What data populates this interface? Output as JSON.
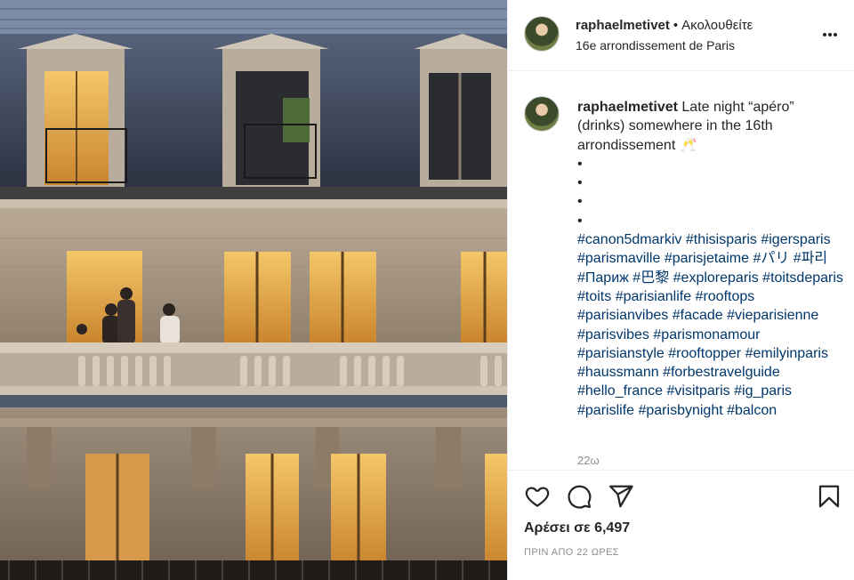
{
  "photo": {
    "alt": ""
  },
  "header": {
    "username": "raphaelmetivet",
    "separator": "•",
    "follow_label": "Ακολουθείτε",
    "location": "16e arrondissement de Paris",
    "more_icon": "more-dots-icon"
  },
  "caption": {
    "username": "raphaelmetivet",
    "text": "Late night “apéro” (drinks) somewhere in the 16th arrondissement 🥂",
    "dots": [
      "•",
      "•",
      "•",
      "•"
    ],
    "hashtags": [
      "#canon5dmarkiv",
      "#thisisparis",
      "#igersparis",
      "#parismaville",
      "#parisjetaime",
      "#パリ",
      "#파리",
      "#Париж",
      "#巴黎",
      "#exploreparis",
      "#toitsdeparis",
      "#toits",
      "#parisianlife",
      "#rooftops",
      "#parisianvibes",
      "#facade",
      "#vieparisienne",
      "#parisvibes",
      "#parismonamour",
      "#parisianstyle",
      "#rooftopper",
      "#emilyinparis",
      "#haussmann",
      "#forbestravelguide",
      "#hello_france",
      "#visitparis",
      "#ig_paris",
      "#parislife",
      "#parisbynight",
      "#balcon"
    ],
    "time_ago": "22ω"
  },
  "actions": {
    "like_icon": "heart-icon",
    "comment_icon": "comment-icon",
    "share_icon": "share-paper-plane-icon",
    "save_icon": "bookmark-icon"
  },
  "likes": "Αρέσει σε 6,497",
  "posted": "ΠΡΙΝ ΑΠΟ 22 ΩΡΕΣ",
  "colors": {
    "text": "#262626",
    "hashtag": "#00376b",
    "muted": "#8e8e8e",
    "border": "#efefef"
  }
}
